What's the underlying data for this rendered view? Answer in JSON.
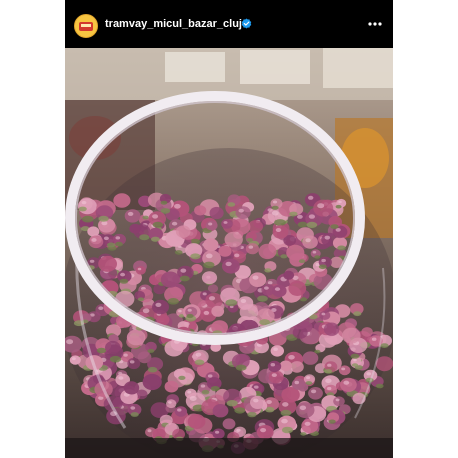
{
  "post": {
    "username": "tramvay_micul_bazar_cluj",
    "verified": true,
    "avatar_icon": "tram-logo-icon",
    "more_icon": "more-horizontal-icon",
    "photo_subject": "dried-rosebuds-in-glass-jar"
  },
  "colors": {
    "background": "#000000",
    "text": "#ffffff",
    "verified_badge": "#1d9bf0",
    "rosebud_pink": "#c0607d",
    "rosebud_purple": "#8e4a78"
  }
}
